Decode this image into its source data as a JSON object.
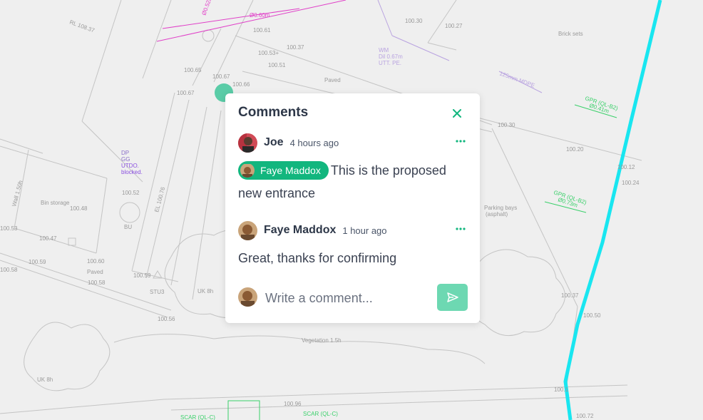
{
  "comments_panel": {
    "title": "Comments",
    "close_icon": "close-icon",
    "comments": [
      {
        "author": "Joe",
        "time": "4 hours ago",
        "mention": "Faye Maddox",
        "text": "This is the proposed new entrance"
      },
      {
        "author": "Faye Maddox",
        "time": "1 hour ago",
        "text": "Great, thanks for confirming"
      }
    ],
    "composer": {
      "placeholder": "Write a comment...",
      "send_icon": "send-icon"
    },
    "accent_color": "#12b67e"
  },
  "map": {
    "labels": {
      "rl": "RL 108.37",
      "w0": "Ø0.60m",
      "w1": "Ø0.52m",
      "n1": "100.61",
      "n2": "100.65",
      "n3": "100.67",
      "n4": "100.67",
      "n5": "100.66",
      "n6": "100.53+",
      "n7": "100.37",
      "n8": "100.51",
      "paved1": "Paved",
      "wm": "WM",
      "dil": "Dil 0.67m",
      "utt": "UTT. PE.",
      "n9": "100.30",
      "n10": "100.27",
      "brick": "Brick sets",
      "mdpe": "125mm MDPE",
      "gpr1": "GPR (QL-B2)",
      "gpr1d": "Ø0.41m",
      "n11": "100.30",
      "n12": "100.20",
      "n13": "100.12",
      "n14": "100.24",
      "gpr2": "GPR (QL-B2)",
      "gpr2d": "Ø0.73m",
      "parking": "Parking bays",
      "asphalt": "(asphalt)",
      "dp": "DP",
      "gg": "GG",
      "utdo": "UTDO.",
      "blocked": "blocked.",
      "n15": "100.52",
      "bin": "Bin storage",
      "n16": "100.48",
      "bu": "BU",
      "n17": "100.47",
      "wall": "Wall 1.50h",
      "n18": "100.53",
      "n19": "100.59",
      "n20": "100.60",
      "paved2": "Paved",
      "n21": "100.58",
      "n22": "100.59",
      "stu": "STU3",
      "uk1": "UK 8h",
      "n23": "100.56",
      "n24": "100.58",
      "veg": "Vegetation 1.5h",
      "uk2": "UK 8h",
      "n25": "100.37",
      "n26": "100.50",
      "n27": "100.96",
      "scar1": "SCAR (QL-C)",
      "scar2": "SCAR (QL-C)",
      "n28": "100.72",
      "n29": "100.1",
      "el": "EL 100.76"
    }
  }
}
